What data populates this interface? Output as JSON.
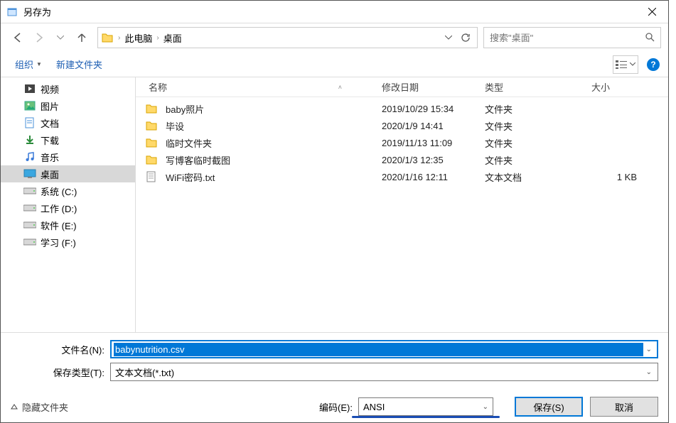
{
  "title": "另存为",
  "breadcrumbs": [
    "此电脑",
    "桌面"
  ],
  "search_placeholder": "搜索\"桌面\"",
  "toolbar": {
    "organize": "组织",
    "newfolder": "新建文件夹"
  },
  "tree": [
    {
      "icon": "video",
      "label": "视频"
    },
    {
      "icon": "pictures",
      "label": "图片"
    },
    {
      "icon": "documents",
      "label": "文档"
    },
    {
      "icon": "downloads",
      "label": "下载"
    },
    {
      "icon": "music",
      "label": "音乐"
    },
    {
      "icon": "desktop",
      "label": "桌面",
      "selected": true
    },
    {
      "icon": "drive",
      "label": "系统 (C:)"
    },
    {
      "icon": "drive",
      "label": "工作 (D:)"
    },
    {
      "icon": "drive",
      "label": "软件 (E:)"
    },
    {
      "icon": "drive",
      "label": "学习 (F:)"
    }
  ],
  "columns": {
    "name": "名称",
    "date": "修改日期",
    "type": "类型",
    "size": "大小"
  },
  "rows": [
    {
      "icon": "folder",
      "name": "baby照片",
      "date": "2019/10/29 15:34",
      "type": "文件夹",
      "size": ""
    },
    {
      "icon": "folder",
      "name": "毕设",
      "date": "2020/1/9 14:41",
      "type": "文件夹",
      "size": ""
    },
    {
      "icon": "folder",
      "name": "临时文件夹",
      "date": "2019/11/13 11:09",
      "type": "文件夹",
      "size": ""
    },
    {
      "icon": "folder",
      "name": "写博客临时截图",
      "date": "2020/1/3 12:35",
      "type": "文件夹",
      "size": ""
    },
    {
      "icon": "textfile",
      "name": "WiFi密码.txt",
      "date": "2020/1/16 12:11",
      "type": "文本文档",
      "size": "1 KB"
    }
  ],
  "labels": {
    "filename": "文件名(N):",
    "filetype": "保存类型(T):",
    "encoding": "编码(E):",
    "hidefolders": "隐藏文件夹",
    "save": "保存(S)",
    "cancel": "取消"
  },
  "values": {
    "filename": "babynutrition.csv",
    "filetype": "文本文档(*.txt)",
    "encoding": "ANSI"
  }
}
